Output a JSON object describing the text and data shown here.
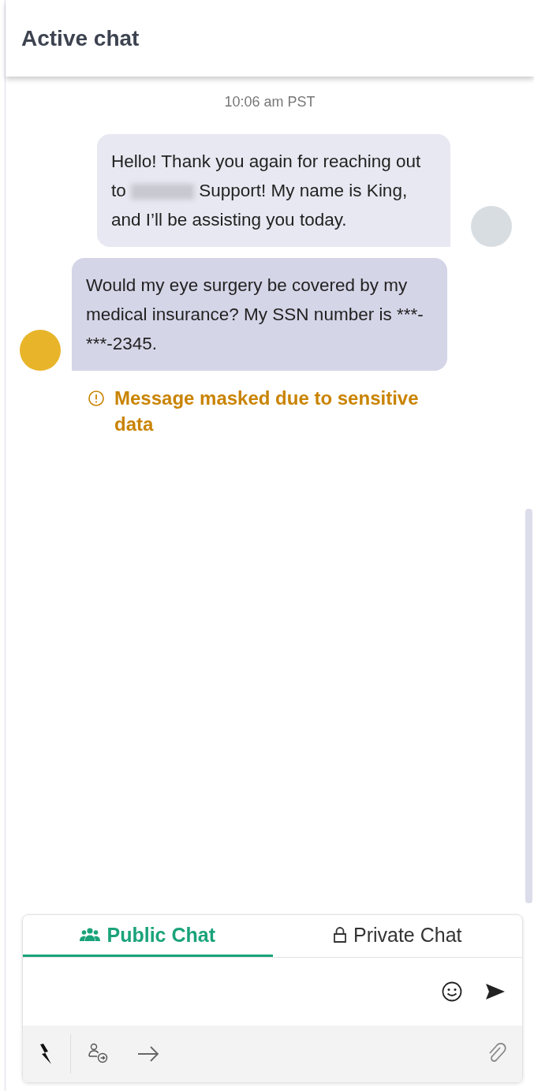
{
  "header": {
    "title": "Active chat"
  },
  "timestamp": "10:06 am PST",
  "messages": [
    {
      "kind": "agent",
      "text_before": "Hello! Thank you again for reaching out to",
      "redacted": true,
      "text_after": "Support! My name is King, and I’ll be assisting you today."
    },
    {
      "kind": "customer",
      "text_before": "Would my eye surgery be covered by my medical insurance? My SSN number is ***-***-2345.",
      "redacted": false,
      "notice": "Message masked due to sensitive data"
    }
  ],
  "composer": {
    "tabs": [
      {
        "label": "Public Chat",
        "selected": true,
        "kind": "public"
      },
      {
        "label": "Private Chat",
        "selected": false,
        "kind": "private"
      }
    ]
  }
}
